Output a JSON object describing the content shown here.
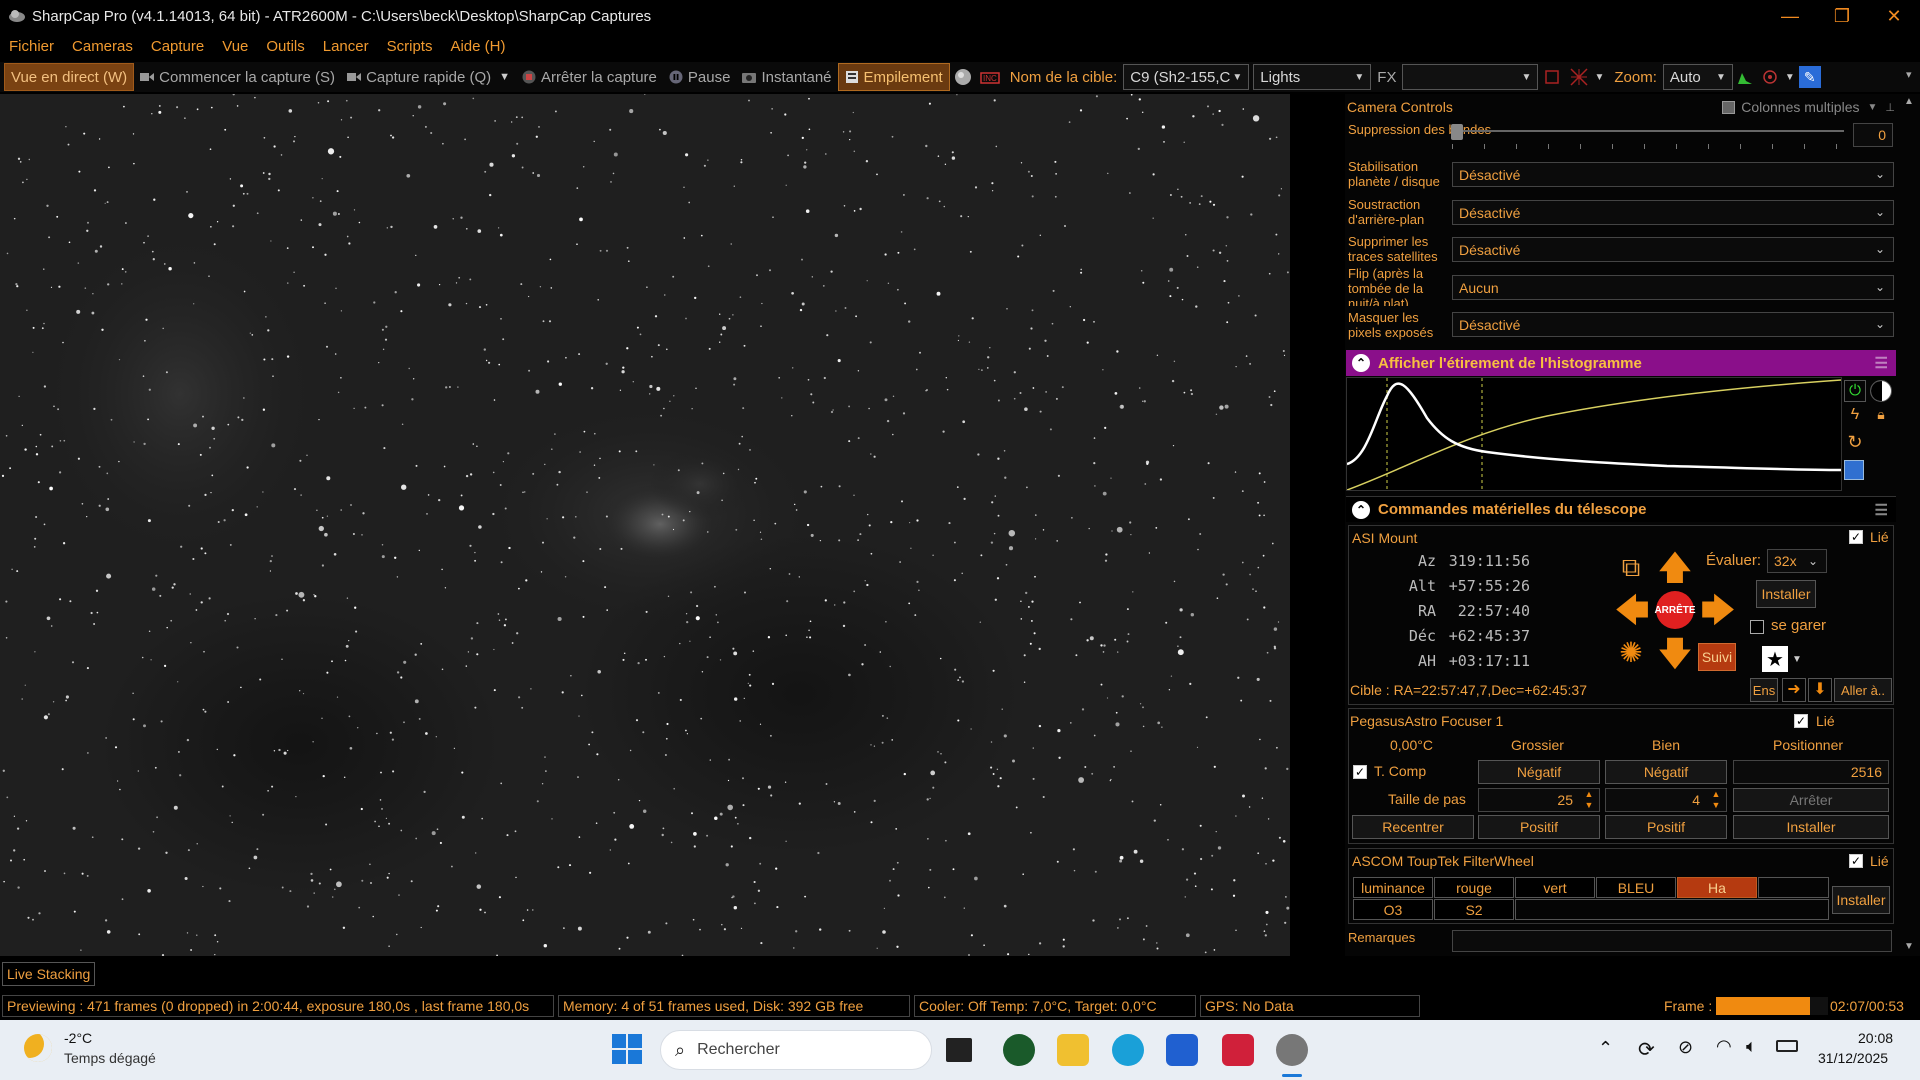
{
  "window": {
    "title": "SharpCap Pro (v4.1.14013, 64 bit) - ATR2600M - C:\\Users\\beck\\Desktop\\SharpCap Captures",
    "minimize": "—",
    "restore": "❐",
    "close": "✕"
  },
  "menu": [
    "Fichier",
    "Cameras",
    "Capture",
    "Vue",
    "Outils",
    "Lancer",
    "Scripts",
    "Aide (H)"
  ],
  "toolbar": {
    "live_view": "Vue en direct (W)",
    "start_capture": "Commencer la capture (S)",
    "quick_capture": "Capture rapide (Q)",
    "stop_capture": "Arrêter la capture",
    "pause": "Pause",
    "snapshot": "Instantané",
    "stacking": "Empilement",
    "target_label": "Nom de la cible:",
    "target_value": "C9 (Sh2-155,C",
    "frame_type": "Lights",
    "fx_label": "FX",
    "fx_value": "",
    "zoom_label": "Zoom:",
    "zoom_value": "Auto"
  },
  "camera_controls": {
    "title": "Camera Controls",
    "multi_columns": "Colonnes multiples",
    "rows": [
      {
        "label": "Suppression des bandes",
        "value": "0"
      },
      {
        "label": "Stabilisation planète / disque",
        "value": "Désactivé"
      },
      {
        "label": "Soustraction d'arrière-plan",
        "value": "Désactivé"
      },
      {
        "label": "Supprimer les traces satellites",
        "value": "Désactivé"
      },
      {
        "label": "Flip (après la tombée de la nuit/à plat)",
        "value": "Aucun"
      },
      {
        "label": "Masquer les pixels exposés",
        "value": "Désactivé"
      }
    ]
  },
  "histogram": {
    "title": "Afficher l'étirement de l'histogramme",
    "accent": "#8a0f8a"
  },
  "telescope": {
    "title": "Commandes matérielles du télescope",
    "mount_name": "ASI Mount",
    "linked": "Lié",
    "coords": [
      {
        "label": "Az",
        "value": "319:11:56"
      },
      {
        "label": "Alt",
        "value": "+57:55:26"
      },
      {
        "label": "RA",
        "value": "22:57:40"
      },
      {
        "label": "Déc",
        "value": "+62:45:37"
      },
      {
        "label": "AH",
        "value": "+03:17:11"
      }
    ],
    "stop": "ARRÊTE",
    "rate_label": "Évaluer:",
    "rate_value": "32x",
    "install": "Installer",
    "park": "se garer",
    "track": "Suivi",
    "target_line": "Cible : RA=22:57:47,7,Dec=+62:45:37",
    "ens": "Ens",
    "goto": "Aller à.."
  },
  "focuser": {
    "name": "PegasusAstro Focuser 1",
    "linked": "Lié",
    "temp": "0,00°C",
    "coarse": "Grossier",
    "fine": "Bien",
    "position_label": "Positionner",
    "tcomp": "T. Comp",
    "negative": "Négatif",
    "position_value": "2516",
    "step_label": "Taille de pas",
    "coarse_step": "25",
    "fine_step": "4",
    "stop": "Arrêter",
    "recenter": "Recentrer",
    "positive": "Positif",
    "install": "Installer"
  },
  "filterwheel": {
    "name": "ASCOM ToupTek FilterWheel",
    "linked": "Lié",
    "filters_row1": [
      "luminance",
      "rouge",
      "vert",
      "BLEU",
      "Ha"
    ],
    "filters_row2": [
      "O3",
      "S2"
    ],
    "active": "Ha",
    "install": "Installer"
  },
  "notes_label": "Remarques",
  "live_stacking_tab": "Live Stacking",
  "status": {
    "preview": "Previewing : 471 frames (0 dropped) in 2:00:44, exposure 180,0s , last frame 180,0s",
    "memory": "Memory: 4 of 51 frames used, Disk: 392 GB free",
    "cooler": "Cooler: Off Temp: 7,0°C, Target: 0,0°C",
    "gps": "GPS: No Data",
    "frame_label": "Frame :",
    "frame_progress": 0.84,
    "frame_time": "02:07/00:53"
  },
  "taskbar": {
    "temp": "-2°C",
    "weather": "Temps dégagé",
    "search": "Rechercher",
    "time": "20:08",
    "date": "31/12/2025"
  },
  "colors": {
    "orange": "#f0a040",
    "filter_active": "#b53a10"
  }
}
